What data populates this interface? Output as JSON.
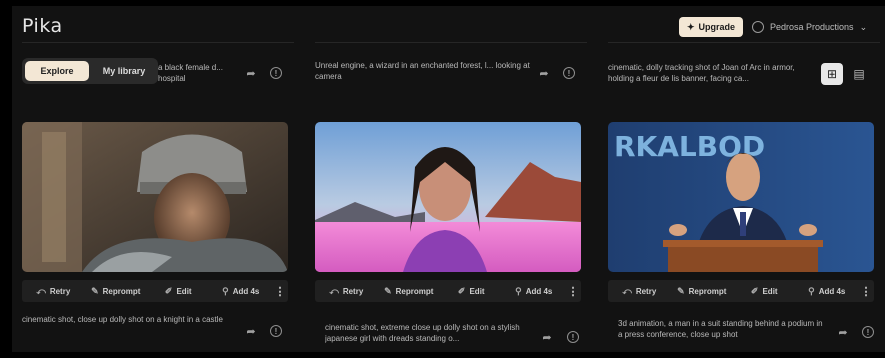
{
  "app": {
    "logo": "Pika"
  },
  "header": {
    "upgrade_label": "Upgrade",
    "user_name": "Pedrosa Productions",
    "upgrade_icon": "sparkle-icon",
    "user_icon": "circle-avatar-icon"
  },
  "tabs": {
    "explore": "Explore",
    "library": "My library"
  },
  "view": {
    "grid_icon": "grid-icon",
    "list_icon": "list-icon"
  },
  "toolbar": {
    "retry": "Retry",
    "reprompt": "Reprompt",
    "edit": "Edit",
    "add4s": "Add 4s",
    "more": "⋮"
  },
  "columns": [
    {
      "top_prompt": "a black female d... hospital",
      "bottom_prompt": "cinematic shot, close up dolly shot on a knight in a castle",
      "thumb_theme": "knight"
    },
    {
      "top_prompt": "Unreal engine, a wizard in an enchanted forest, l... looking at camera",
      "bottom_prompt": "cinematic shot, extreme close up dolly shot on a stylish japanese girl with dreads standing o...",
      "thumb_theme": "girl"
    },
    {
      "top_prompt": "cinematic, dolly tracking shot of Joan of Arc in armor, holding a fleur de lis banner, facing ca...",
      "bottom_prompt": "3d animation, a man in a suit standing behind a podium in a press conference, close up shot",
      "thumb_theme": "speaker",
      "thumb_text": "RKALBOD"
    }
  ]
}
